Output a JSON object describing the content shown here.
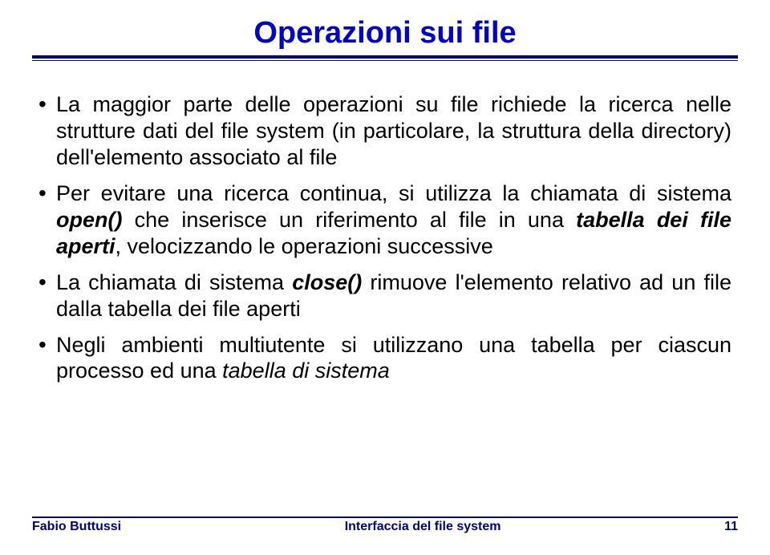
{
  "title": "Operazioni sui file",
  "bullets": [
    {
      "parts": [
        {
          "text": "La maggior parte delle operazioni su file richiede la ricerca nelle strutture dati del file system (in particolare, la struttura della directory) dell'elemento associato al file",
          "style": "normal"
        }
      ]
    },
    {
      "parts": [
        {
          "text": "Per evitare una ricerca continua, si utilizza la chiamata di sistema ",
          "style": "normal"
        },
        {
          "text": "open()",
          "style": "bolditalic"
        },
        {
          "text": " che inserisce un riferimento al file in una ",
          "style": "normal"
        },
        {
          "text": "tabella dei file aperti",
          "style": "bolditalic"
        },
        {
          "text": ", velocizzando le operazioni successive",
          "style": "normal"
        }
      ]
    },
    {
      "parts": [
        {
          "text": "La chiamata di sistema ",
          "style": "normal"
        },
        {
          "text": "close()",
          "style": "bolditalic"
        },
        {
          "text": " rimuove l'elemento relativo ad un file dalla tabella dei file aperti",
          "style": "normal"
        }
      ]
    },
    {
      "parts": [
        {
          "text": "Negli ambienti multiutente si utilizzano una tabella per ciascun processo ed una ",
          "style": "normal"
        },
        {
          "text": "tabella di sistema",
          "style": "italic"
        }
      ]
    }
  ],
  "footer": {
    "left": "Fabio Buttussi",
    "center": "Interfaccia del file system",
    "right": "11"
  }
}
